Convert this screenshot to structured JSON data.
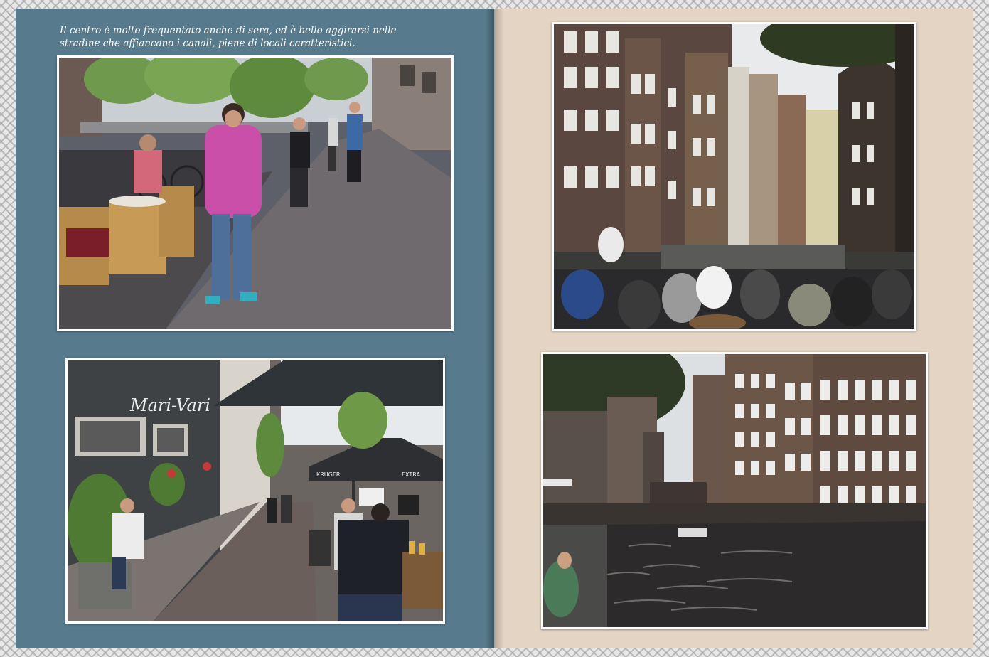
{
  "caption": {
    "line1": "Il centro è molto frequentato anche di sera, ed è bello aggirarsi nelle",
    "line2": "stradine che affiancano i canali, piene di locali caratteristici."
  },
  "photos": {
    "street_sign": "Mari-Vari",
    "awning_text": "EXTRA",
    "awning_text2": "KRUGER"
  },
  "colors": {
    "left_page": "#577b8c",
    "right_page": "#e4d4c4",
    "border_pattern": "#e7e7e7"
  }
}
